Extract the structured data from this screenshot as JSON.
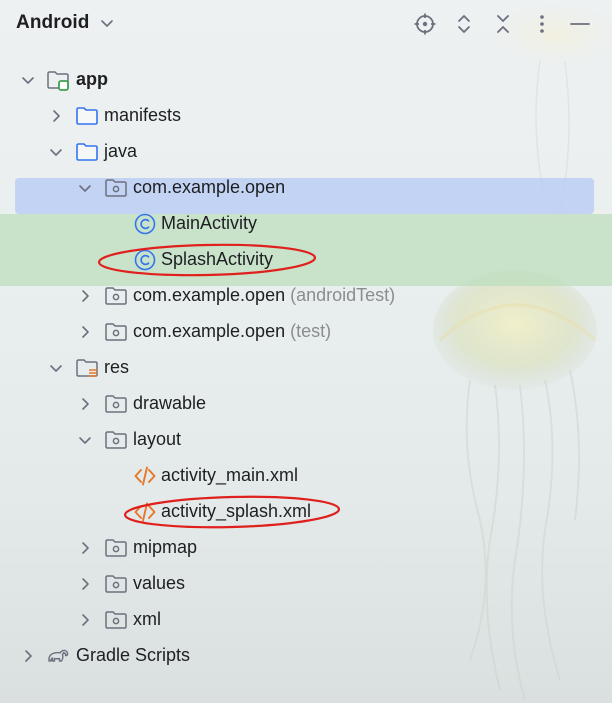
{
  "panel": {
    "title": "Android"
  },
  "toolbar": {
    "buttons": [
      {
        "icon": "locate-crosshair-icon",
        "name": "locate-button"
      },
      {
        "icon": "expand-all-icon",
        "name": "expand-all-button"
      },
      {
        "icon": "collapse-all-icon",
        "name": "collapse-all-button"
      },
      {
        "icon": "more-options-icon",
        "name": "options-button"
      },
      {
        "icon": "minimize-icon",
        "name": "hide-panel-button"
      }
    ]
  },
  "tree": {
    "items": [
      {
        "label": "app",
        "suffix": "",
        "icon": "module-folder-icon",
        "expanded": true
      },
      {
        "label": "manifests",
        "suffix": "",
        "icon": "folder-icon",
        "expanded": false
      },
      {
        "label": "java",
        "suffix": "",
        "icon": "folder-icon",
        "expanded": true
      },
      {
        "label": "com.example.open",
        "suffix": "",
        "icon": "package-icon",
        "expanded": true
      },
      {
        "label": "MainActivity",
        "suffix": "",
        "icon": "class-icon"
      },
      {
        "label": "SplashActivity",
        "suffix": "",
        "icon": "class-icon",
        "selected": true
      },
      {
        "label": "com.example.open",
        "suffix": "(androidTest)",
        "icon": "package-icon",
        "expanded": false
      },
      {
        "label": "com.example.open",
        "suffix": "(test)",
        "icon": "package-icon",
        "expanded": false
      },
      {
        "label": "res",
        "suffix": "",
        "icon": "resources-folder-icon",
        "expanded": true
      },
      {
        "label": "drawable",
        "suffix": "",
        "icon": "package-icon",
        "expanded": false
      },
      {
        "label": "layout",
        "suffix": "",
        "icon": "package-icon",
        "expanded": true
      },
      {
        "label": "activity_main.xml",
        "suffix": "",
        "icon": "xml-file-icon"
      },
      {
        "label": "activity_splash.xml",
        "suffix": "",
        "icon": "xml-file-icon"
      },
      {
        "label": "mipmap",
        "suffix": "",
        "icon": "package-icon",
        "expanded": false
      },
      {
        "label": "values",
        "suffix": "",
        "icon": "package-icon",
        "expanded": false
      },
      {
        "label": "xml",
        "suffix": "",
        "icon": "package-icon",
        "expanded": false
      },
      {
        "label": "Gradle Scripts",
        "suffix": "",
        "icon": "gradle-elephant-icon",
        "expanded": false
      }
    ]
  },
  "colors": {
    "selection": "#bccef4",
    "vcs_highlight": "#bedcbe",
    "annotation": "#e0201c",
    "class_icon": "#3574f0",
    "folder_icon": "#3574f0",
    "xml_icon": "#e8762b"
  }
}
